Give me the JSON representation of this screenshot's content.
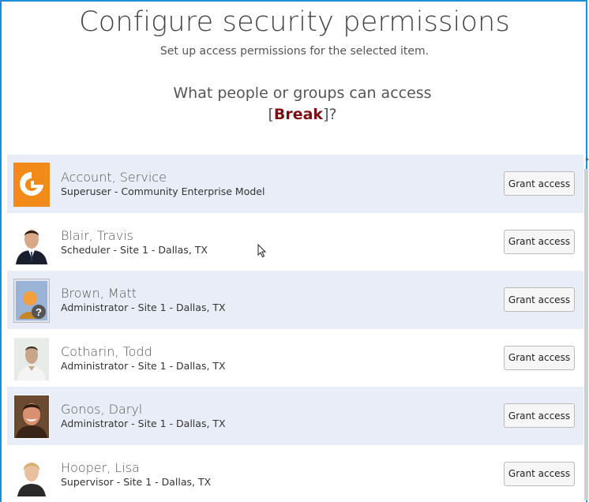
{
  "header": {
    "title": "Configure security permissions",
    "subtitle": "Set up access permissions for the selected item.",
    "question_prefix": "What people or groups can access",
    "open_bracket": "[",
    "item_name": "Break",
    "close_suffix": "]?"
  },
  "users": [
    {
      "name": "Account, Service",
      "role": "Superuser - Community Enterprise Model",
      "grant_label": "Grant access",
      "avatar_icon": "service-account-icon"
    },
    {
      "name": "Blair, Travis",
      "role": "Scheduler - Site 1 - Dallas, TX",
      "grant_label": "Grant access",
      "avatar_icon": "user-photo-icon"
    },
    {
      "name": "Brown, Matt",
      "role": "Administrator - Site 1 - Dallas, TX",
      "grant_label": "Grant access",
      "avatar_icon": "unknown-user-icon"
    },
    {
      "name": "Cotharin, Todd",
      "role": "Administrator - Site 1 - Dallas, TX",
      "grant_label": "Grant access",
      "avatar_icon": "user-photo-icon"
    },
    {
      "name": "Gonos, Daryl",
      "role": "Administrator - Site 1 - Dallas, TX",
      "grant_label": "Grant access",
      "avatar_icon": "user-photo-icon"
    },
    {
      "name": "Hooper, Lisa",
      "role": "Supervisor - Site 1 - Dallas, TX",
      "grant_label": "Grant access",
      "avatar_icon": "user-photo-icon"
    }
  ],
  "colors": {
    "frame_border": "#1e8fd6",
    "row_alt_background": "#e9edf7",
    "item_name": "#7a1014",
    "service_account_orange": "#f28a1a"
  }
}
